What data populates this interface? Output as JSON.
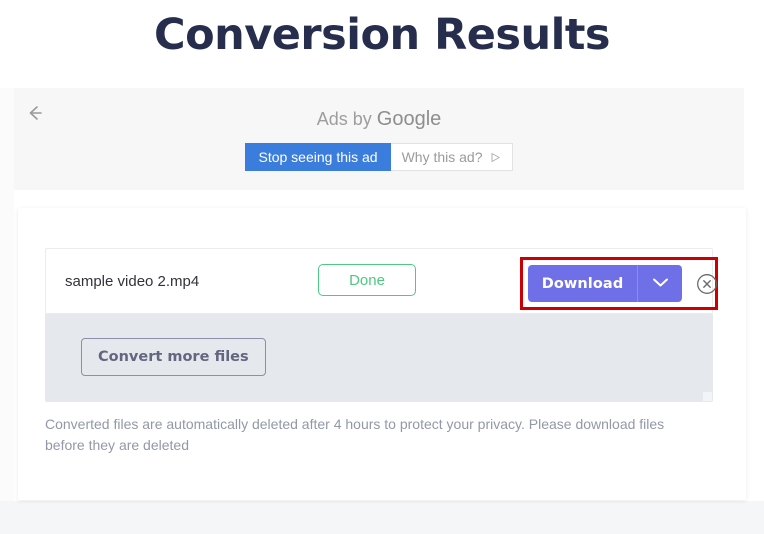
{
  "page": {
    "title": "Conversion Results",
    "background_color": "#ffffff",
    "bottom_background_color": "#f5f6f8"
  },
  "ad": {
    "back_arrow_icon": "arrow-left-icon",
    "label_prefix": "Ads by ",
    "label_brand": "Google",
    "stop_button_label": "Stop seeing this ad",
    "stop_button_color": "#3b7ddd",
    "why_button_label": "Why this ad?",
    "why_button_icon": "play-triangle-icon",
    "band_color": "#f7f7f7"
  },
  "file_row": {
    "file_name": "sample video 2.mp4",
    "status_label": "Done",
    "status_color": "#4fc884",
    "download_label": "Download",
    "download_color": "#6f70e8",
    "dropdown_icon": "chevron-down-icon",
    "remove_icon": "close-circle-icon"
  },
  "annotation": {
    "color": "#cc0000",
    "target": "download-button-group"
  },
  "actions": {
    "convert_more_label": "Convert more files",
    "panel_color": "#e5e8ed"
  },
  "footer": {
    "note": "Converted files are automatically deleted after 4 hours to protect your privacy. Please download files before they are deleted"
  }
}
